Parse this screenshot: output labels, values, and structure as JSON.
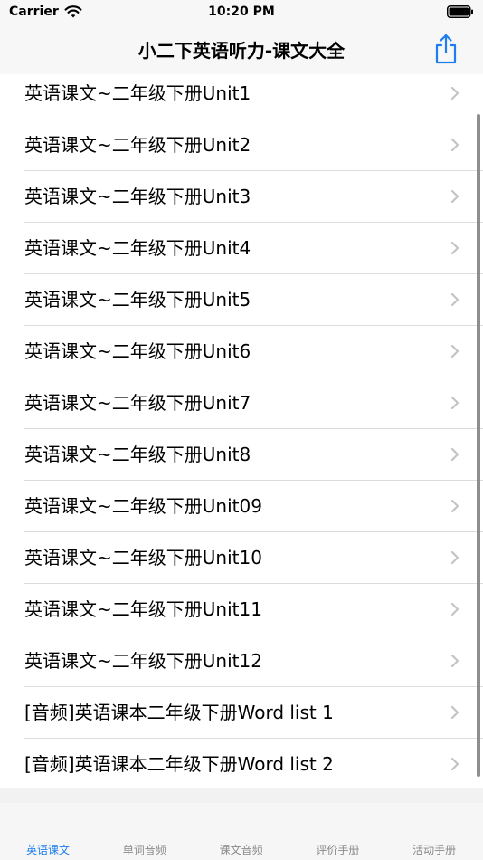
{
  "status_bar": {
    "carrier": "Carrier",
    "time": "10:20 PM"
  },
  "nav": {
    "title": "小二下英语听力-课文大全",
    "accent_color": "#1e7ef0"
  },
  "list": {
    "items": [
      {
        "label": "英语课文~二年级下册Unit1"
      },
      {
        "label": "英语课文~二年级下册Unit2"
      },
      {
        "label": "英语课文~二年级下册Unit3"
      },
      {
        "label": "英语课文~二年级下册Unit4"
      },
      {
        "label": "英语课文~二年级下册Unit5"
      },
      {
        "label": "英语课文~二年级下册Unit6"
      },
      {
        "label": "英语课文~二年级下册Unit7"
      },
      {
        "label": "英语课文~二年级下册Unit8"
      },
      {
        "label": "英语课文~二年级下册Unit09"
      },
      {
        "label": "英语课文~二年级下册Unit10"
      },
      {
        "label": "英语课文~二年级下册Unit11"
      },
      {
        "label": "英语课文~二年级下册Unit12"
      },
      {
        "label": "[音频]英语课本二年级下册Word list 1"
      },
      {
        "label": "[音频]英语课本二年级下册Word list 2"
      }
    ]
  },
  "tabs": [
    {
      "label": "英语课文",
      "active": true
    },
    {
      "label": "单词音频",
      "active": false
    },
    {
      "label": "课文音频",
      "active": false
    },
    {
      "label": "评价手册",
      "active": false
    },
    {
      "label": "活动手册",
      "active": false
    }
  ]
}
